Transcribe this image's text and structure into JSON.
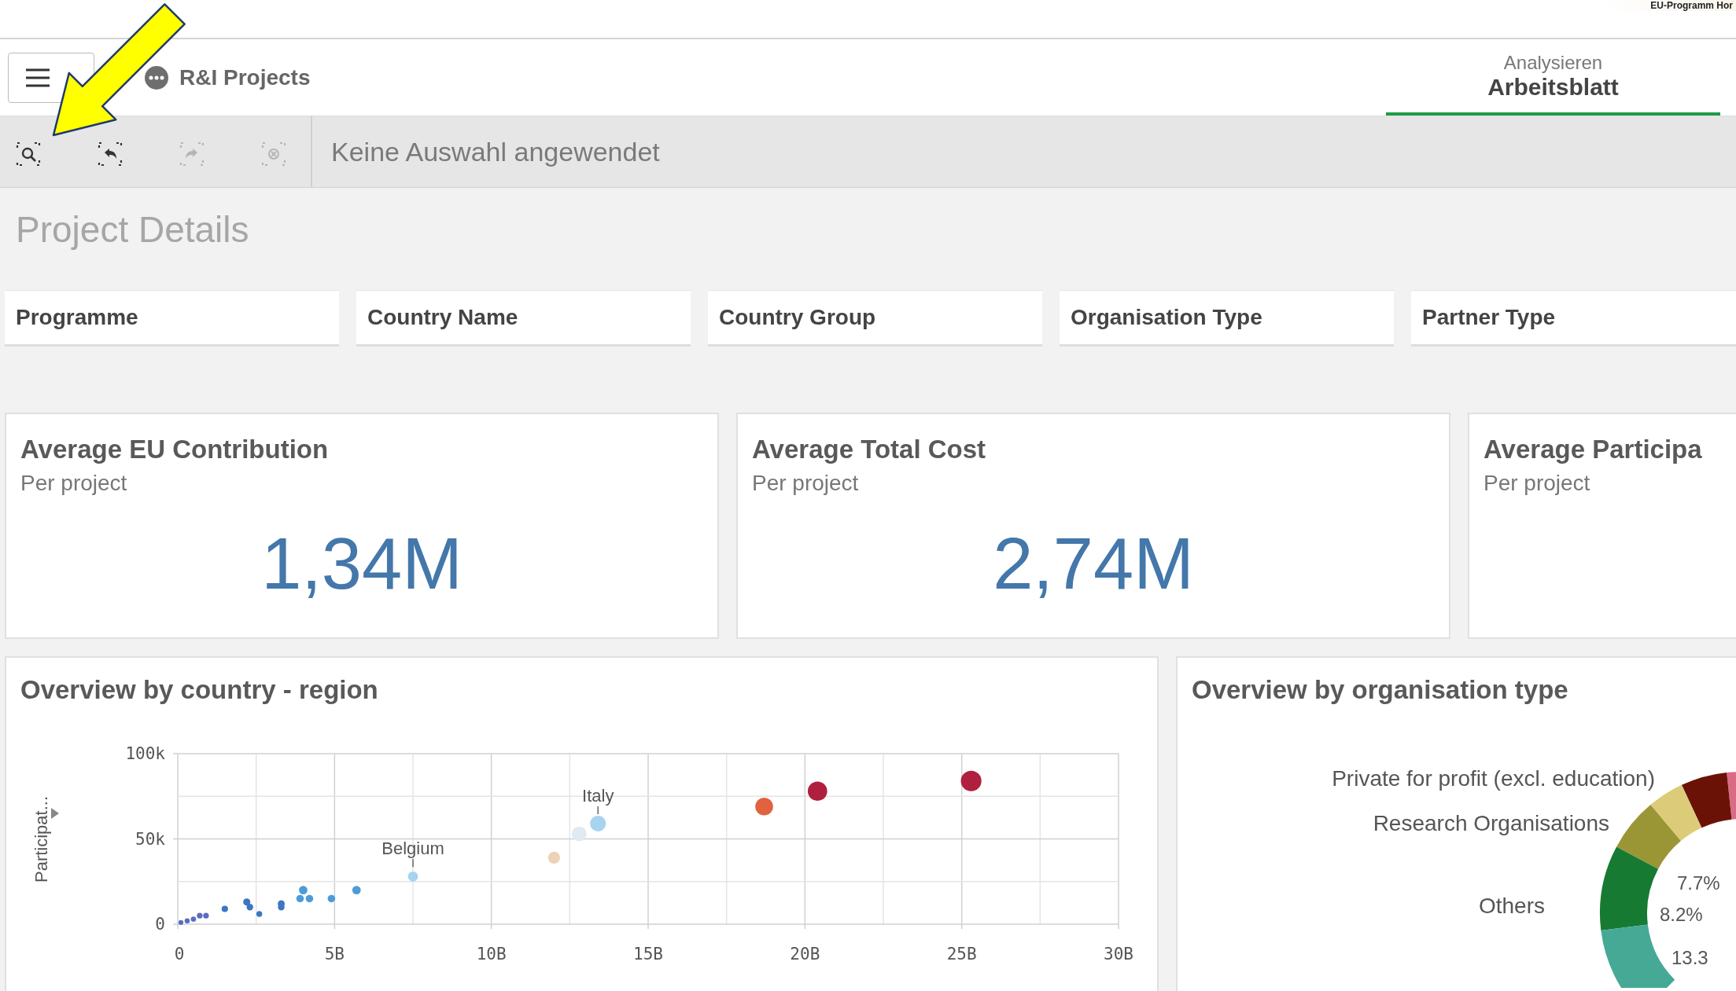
{
  "top_strip": {
    "caption": "EU-Programm Hor"
  },
  "header": {
    "app_title": "R&I Projects",
    "tabs": [
      {
        "caption": "Analysieren",
        "label": "Arbeitsblatt",
        "selected": true
      }
    ]
  },
  "toolbar": {
    "tools": [
      {
        "kind": "search",
        "disabled": false
      },
      {
        "kind": "back",
        "disabled": false
      },
      {
        "kind": "forward",
        "disabled": true
      },
      {
        "kind": "clear",
        "disabled": true
      }
    ],
    "status": "Keine Auswahl angewendet"
  },
  "sheet": {
    "title": "Project Details",
    "filters": [
      {
        "label": "Programme"
      },
      {
        "label": "Country Name"
      },
      {
        "label": "Country Group"
      },
      {
        "label": "Organisation Type"
      },
      {
        "label": "Partner Type"
      }
    ],
    "kpis": [
      {
        "title": "Average EU Contribution",
        "subtitle": "Per project",
        "value": "1,34M"
      },
      {
        "title": "Average Total Cost",
        "subtitle": "Per project",
        "value": "2,74M"
      },
      {
        "title": "Average Participa",
        "subtitle": "Per project"
      }
    ],
    "scatter": {
      "title": "Overview by country - region",
      "chart_data": {
        "type": "scatter",
        "ylabel": "Participat...",
        "xlim": [
          0,
          30
        ],
        "ylim": [
          0,
          100
        ],
        "xticks": [
          {
            "value": 0,
            "label": "0"
          },
          {
            "value": 5,
            "label": "5B"
          },
          {
            "value": 10,
            "label": "10B"
          },
          {
            "value": 15,
            "label": "15B"
          },
          {
            "value": 20,
            "label": "20B"
          },
          {
            "value": 25,
            "label": "25B"
          },
          {
            "value": 30,
            "label": "30B"
          }
        ],
        "yticks": [
          {
            "value": 0,
            "label": "0"
          },
          {
            "value": 50,
            "label": "50k"
          },
          {
            "value": 100,
            "label": "100k"
          }
        ],
        "grid": true,
        "x": [
          25.3,
          20.4,
          18.7,
          12.0,
          12.8,
          13.4,
          7.5,
          5.7,
          4.9,
          4.2,
          3.9,
          4.0,
          3.3,
          3.3,
          2.6,
          2.3,
          2.2,
          1.5,
          0.9,
          0.7,
          0.5,
          0.3,
          0.1
        ],
        "series": [
          {
            "color": "#b01f3e",
            "values": [
              84,
              78,
              null,
              null,
              null,
              null,
              null,
              null,
              null,
              null,
              null,
              null,
              null,
              null,
              null,
              null,
              null,
              null,
              null,
              null,
              null,
              null,
              null
            ]
          },
          {
            "color": "#e0623f",
            "values": [
              null,
              null,
              69,
              null,
              null,
              null,
              null,
              null,
              null,
              null,
              null,
              null,
              null,
              null,
              null,
              null,
              null,
              null,
              null,
              null,
              null,
              null,
              null
            ]
          },
          {
            "color": "#ecd3b6",
            "values": [
              null,
              null,
              null,
              39,
              null,
              null,
              null,
              null,
              null,
              null,
              null,
              null,
              null,
              null,
              null,
              null,
              null,
              null,
              null,
              null,
              null,
              null,
              null
            ]
          },
          {
            "color": "#dfeaf2",
            "values": [
              null,
              null,
              null,
              null,
              53,
              null,
              null,
              null,
              null,
              null,
              null,
              null,
              null,
              null,
              null,
              null,
              null,
              null,
              null,
              null,
              null,
              null,
              null
            ]
          },
          {
            "color": "#a8d3f0",
            "values": [
              null,
              null,
              null,
              null,
              null,
              59,
              28,
              null,
              null,
              null,
              null,
              null,
              null,
              null,
              null,
              null,
              null,
              null,
              null,
              null,
              null,
              null,
              null
            ]
          },
          {
            "color": "#4f9bd7",
            "values": [
              null,
              null,
              null,
              null,
              null,
              null,
              null,
              20,
              15,
              15,
              15,
              20,
              null,
              null,
              null,
              null,
              null,
              null,
              null,
              null,
              null,
              null,
              null
            ]
          },
          {
            "color": "#3b78c2",
            "values": [
              null,
              null,
              null,
              null,
              null,
              null,
              null,
              null,
              null,
              null,
              null,
              null,
              10,
              12,
              6,
              10,
              13,
              9,
              null,
              null,
              null,
              null,
              null
            ]
          },
          {
            "color": "#5b6cc0",
            "values": [
              null,
              null,
              null,
              null,
              null,
              null,
              null,
              null,
              null,
              null,
              null,
              null,
              null,
              null,
              null,
              null,
              null,
              null,
              5,
              5,
              3,
              2,
              1
            ]
          }
        ],
        "annotations": [
          {
            "x": 7.5,
            "y": 28,
            "text": "Belgium"
          },
          {
            "x": 13.4,
            "y": 59,
            "text": "Italy"
          }
        ]
      }
    },
    "donut": {
      "title": "Overview by organisation type",
      "labels": [
        "Private for profit (excl. education)",
        "Research Organisations",
        "Others"
      ],
      "percent_labels": [
        "7.7%",
        "8.2%",
        "13.3"
      ],
      "segments": [
        {
          "color": "#d96b85"
        },
        {
          "color": "#6b1206"
        },
        {
          "color": "#dccb79"
        },
        {
          "color": "#9a9636"
        },
        {
          "color": "#177a33"
        },
        {
          "color": "#45a996"
        }
      ]
    }
  },
  "annotations": [
    {
      "kind": "arrow"
    }
  ]
}
